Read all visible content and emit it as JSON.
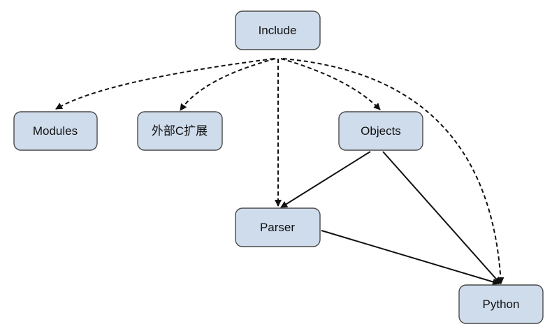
{
  "nodes": {
    "include": "Include",
    "modules": "Modules",
    "external": "外部C扩展",
    "objects": "Objects",
    "parser": "Parser",
    "python": "Python"
  },
  "colors": {
    "node_fill": "#cfdcec",
    "node_border": "#4a4a4a",
    "edge": "#111111"
  },
  "edges": [
    {
      "from": "include",
      "to": "modules",
      "style": "dashed"
    },
    {
      "from": "include",
      "to": "external",
      "style": "dashed"
    },
    {
      "from": "include",
      "to": "objects",
      "style": "dashed"
    },
    {
      "from": "include",
      "to": "parser",
      "style": "dashed"
    },
    {
      "from": "include",
      "to": "python",
      "style": "dashed"
    },
    {
      "from": "objects",
      "to": "parser",
      "style": "solid"
    },
    {
      "from": "objects",
      "to": "python",
      "style": "solid"
    },
    {
      "from": "parser",
      "to": "python",
      "style": "solid"
    }
  ]
}
